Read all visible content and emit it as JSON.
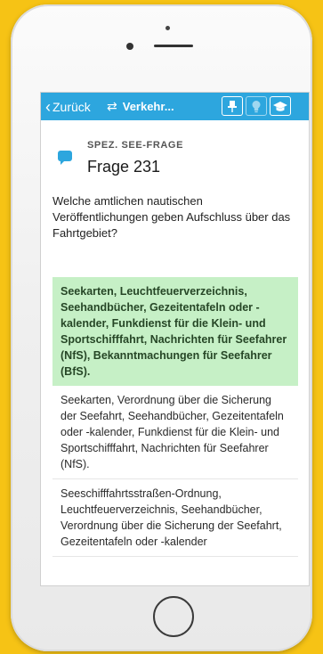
{
  "nav": {
    "back_label": "Zurück",
    "title": "Verkehr...",
    "swap_symbol": "⇄",
    "accent": "#2da6de"
  },
  "question": {
    "category": "SPEZ. SEE-FRAGE",
    "number": "Frage 231",
    "text": "Welche amtlichen nautischen Veröffentlichungen geben Aufschluss über das Fahrtgebiet?"
  },
  "answers": [
    {
      "text": "Seekarten, Leuchtfeuerverzeichnis, Seehandbücher, Gezeitentafeln oder -kalender, Funkdienst für die Klein- und Sportschifffahrt, Nachrichten für Seefahrer (NfS), Bekanntmachungen für Seefahrer (BfS).",
      "correct": true
    },
    {
      "text": "Seekarten, Verordnung über die Sicherung der Seefahrt, Seehandbücher, Gezeitentafeln oder -kalender, Funkdienst für die Klein- und Sportschifffahrt, Nachrichten für Seefahrer (NfS).",
      "correct": false
    },
    {
      "text": "Seeschifffahrtsstraßen-Ordnung, Leuchtfeuerverzeichnis, Seehandbücher, Verordnung über die Sicherung der Seefahrt, Gezeitentafeln oder -kalender",
      "correct": false
    }
  ],
  "colors": {
    "correct_bg": "#c6f0c6",
    "background": "#f6c315"
  },
  "icons": [
    "pin-icon",
    "lightbulb-icon",
    "graduation-cap-icon",
    "speech-bubble-icon",
    "chevron-left-icon",
    "swap-icon"
  ]
}
